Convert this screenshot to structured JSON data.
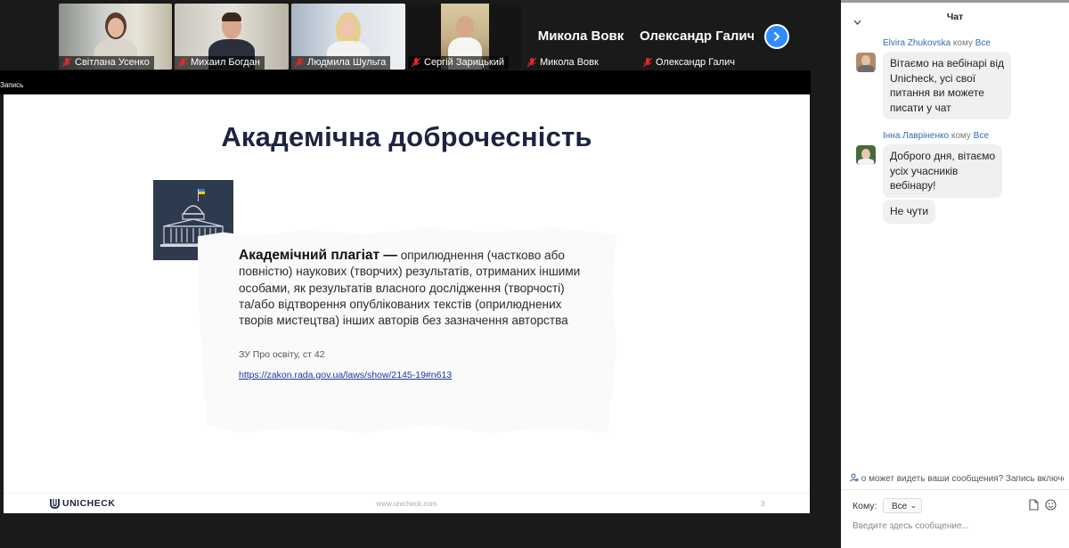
{
  "participants": [
    {
      "name": "Світлана Усенко",
      "muted": true,
      "video": true
    },
    {
      "name": "Михаил Богдан",
      "muted": true,
      "video": true
    },
    {
      "name": "Людмила Шульга",
      "muted": true,
      "video": true
    },
    {
      "name": "Сергій Зарицький",
      "muted": true,
      "video": true
    },
    {
      "name": "Микола Вовк",
      "muted": true,
      "video": false
    },
    {
      "name": "Олександр Галич",
      "muted": true,
      "video": false
    }
  ],
  "recording_label": "Запись",
  "slide": {
    "title": "Академічна доброчесність",
    "definition_term": "Академічний плагіат —",
    "definition_body": " оприлюднення (частково або повністю) наукових (творчих) результатів, отриманих іншими особами, як результатів власного дослідження (творчості) та/або відтворення опублікованих текстів (оприлюднених творів мистецтва) інших авторів без зазначення авторства",
    "source": "ЗУ Про освіту, ст 42",
    "link": "https://zakon.rada.gov.ua/laws/show/2145-19#n613",
    "logo_text": "UNICHECK",
    "footer_site": "www.unicheck.com",
    "page_number": "3"
  },
  "chat": {
    "title": "Чат",
    "messages": [
      {
        "sender": "Elvira Zhukovska",
        "to_word": "кому",
        "recipient": "Все",
        "lines": [
          "Вітаємо на вебінарі від",
          "Unicheck, усі свої",
          "питання ви можете",
          "писати у чат"
        ]
      },
      {
        "sender": "Інна Лавріненко",
        "to_word": "кому",
        "recipient": "Все",
        "lines": [
          "Доброго дня, вітаємо",
          "усіх учасників",
          "вебінару!"
        ]
      },
      {
        "sender": "",
        "to_word": "",
        "recipient": "",
        "lines": [
          "Не чути"
        ]
      }
    ],
    "who_can_see": "о может видеть ваши сообщения? Запись включе",
    "to_label": "Кому:",
    "to_value": "Все",
    "input_placeholder": "Введите здесь сообщение..."
  },
  "colors": {
    "accent": "#2d8cff",
    "slide_title": "#1d2340",
    "chat_name": "#2d6db5",
    "mute_red": "#e02828"
  }
}
